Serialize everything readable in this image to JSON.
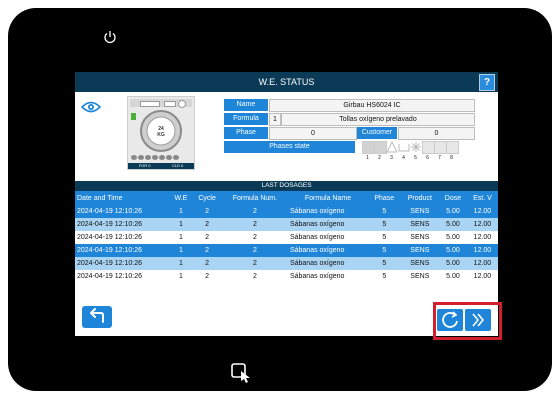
{
  "header": {
    "title": "W.E. STATUS",
    "help_label": "?"
  },
  "machine": {
    "load": "24",
    "unit": "KG",
    "footer_left": "FOR 0",
    "footer_right": "CLD 0"
  },
  "info": {
    "name_label": "Name",
    "name_value": "Girbau HS6024 IC",
    "formula_label": "Formula",
    "formula_num": "1",
    "formula_value": "Tollas oxígeno prelavado",
    "phase_label": "Phase",
    "phase_value": "0",
    "customer_label": "Customer",
    "customer_value": "0",
    "phases_state_label": "Phases state",
    "phase_numbers": [
      "1",
      "2",
      "3",
      "4",
      "5",
      "6",
      "7",
      "8"
    ]
  },
  "dosages": {
    "section_title": "LAST DOSAGES",
    "columns": [
      "Date and Time",
      "W.E",
      "Cycle",
      "Formula Num.",
      "Formula Name",
      "Phase",
      "Product",
      "Dose",
      "Est. V"
    ],
    "rows": [
      [
        "2024-04-19 12:10:26",
        "1",
        "2",
        "2",
        "Sábanas oxígeno",
        "5",
        "SENS",
        "5.00",
        "12.00"
      ],
      [
        "2024-04-19 12:10:26",
        "1",
        "2",
        "2",
        "Sábanas oxígeno",
        "5",
        "SENS",
        "5.00",
        "12.00"
      ],
      [
        "2024-04-19 12:10:26",
        "1",
        "2",
        "2",
        "Sábanas oxígeno",
        "5",
        "SENS",
        "5.00",
        "12.00"
      ],
      [
        "2024-04-19 12:10:26",
        "1",
        "2",
        "2",
        "Sábanas oxígeno",
        "5",
        "SENS",
        "5.00",
        "12.00"
      ],
      [
        "2024-04-19 12:10:26",
        "1",
        "2",
        "2",
        "Sábanas oxígeno",
        "5",
        "SENS",
        "5.00",
        "12.00"
      ],
      [
        "2024-04-19 12:10:26",
        "1",
        "2",
        "2",
        "Sábanas oxígeno",
        "5",
        "SENS",
        "5.00",
        "12.00"
      ]
    ]
  },
  "colors": {
    "accent": "#1e85d8",
    "titlebar": "#0b3a57",
    "highlight": "#d21f2b",
    "row_light": "#a9d4f3"
  }
}
